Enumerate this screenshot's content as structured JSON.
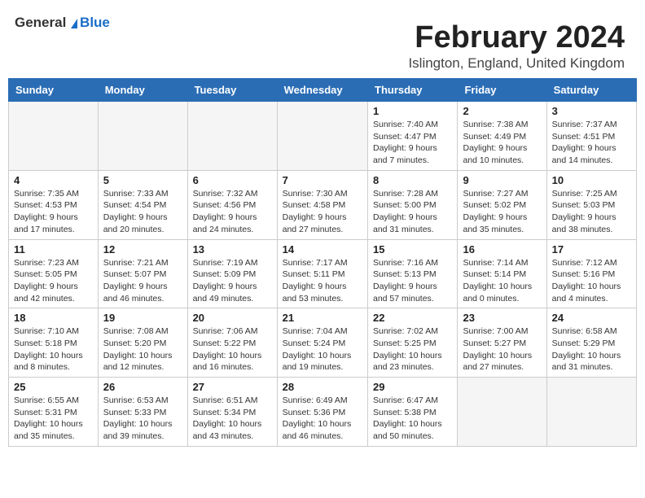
{
  "logo": {
    "general": "General",
    "blue": "Blue"
  },
  "header": {
    "title": "February 2024",
    "subtitle": "Islington, England, United Kingdom"
  },
  "weekdays": [
    "Sunday",
    "Monday",
    "Tuesday",
    "Wednesday",
    "Thursday",
    "Friday",
    "Saturday"
  ],
  "weeks": [
    [
      {
        "num": "",
        "info": ""
      },
      {
        "num": "",
        "info": ""
      },
      {
        "num": "",
        "info": ""
      },
      {
        "num": "",
        "info": ""
      },
      {
        "num": "1",
        "info": "Sunrise: 7:40 AM\nSunset: 4:47 PM\nDaylight: 9 hours\nand 7 minutes."
      },
      {
        "num": "2",
        "info": "Sunrise: 7:38 AM\nSunset: 4:49 PM\nDaylight: 9 hours\nand 10 minutes."
      },
      {
        "num": "3",
        "info": "Sunrise: 7:37 AM\nSunset: 4:51 PM\nDaylight: 9 hours\nand 14 minutes."
      }
    ],
    [
      {
        "num": "4",
        "info": "Sunrise: 7:35 AM\nSunset: 4:53 PM\nDaylight: 9 hours\nand 17 minutes."
      },
      {
        "num": "5",
        "info": "Sunrise: 7:33 AM\nSunset: 4:54 PM\nDaylight: 9 hours\nand 20 minutes."
      },
      {
        "num": "6",
        "info": "Sunrise: 7:32 AM\nSunset: 4:56 PM\nDaylight: 9 hours\nand 24 minutes."
      },
      {
        "num": "7",
        "info": "Sunrise: 7:30 AM\nSunset: 4:58 PM\nDaylight: 9 hours\nand 27 minutes."
      },
      {
        "num": "8",
        "info": "Sunrise: 7:28 AM\nSunset: 5:00 PM\nDaylight: 9 hours\nand 31 minutes."
      },
      {
        "num": "9",
        "info": "Sunrise: 7:27 AM\nSunset: 5:02 PM\nDaylight: 9 hours\nand 35 minutes."
      },
      {
        "num": "10",
        "info": "Sunrise: 7:25 AM\nSunset: 5:03 PM\nDaylight: 9 hours\nand 38 minutes."
      }
    ],
    [
      {
        "num": "11",
        "info": "Sunrise: 7:23 AM\nSunset: 5:05 PM\nDaylight: 9 hours\nand 42 minutes."
      },
      {
        "num": "12",
        "info": "Sunrise: 7:21 AM\nSunset: 5:07 PM\nDaylight: 9 hours\nand 46 minutes."
      },
      {
        "num": "13",
        "info": "Sunrise: 7:19 AM\nSunset: 5:09 PM\nDaylight: 9 hours\nand 49 minutes."
      },
      {
        "num": "14",
        "info": "Sunrise: 7:17 AM\nSunset: 5:11 PM\nDaylight: 9 hours\nand 53 minutes."
      },
      {
        "num": "15",
        "info": "Sunrise: 7:16 AM\nSunset: 5:13 PM\nDaylight: 9 hours\nand 57 minutes."
      },
      {
        "num": "16",
        "info": "Sunrise: 7:14 AM\nSunset: 5:14 PM\nDaylight: 10 hours\nand 0 minutes."
      },
      {
        "num": "17",
        "info": "Sunrise: 7:12 AM\nSunset: 5:16 PM\nDaylight: 10 hours\nand 4 minutes."
      }
    ],
    [
      {
        "num": "18",
        "info": "Sunrise: 7:10 AM\nSunset: 5:18 PM\nDaylight: 10 hours\nand 8 minutes."
      },
      {
        "num": "19",
        "info": "Sunrise: 7:08 AM\nSunset: 5:20 PM\nDaylight: 10 hours\nand 12 minutes."
      },
      {
        "num": "20",
        "info": "Sunrise: 7:06 AM\nSunset: 5:22 PM\nDaylight: 10 hours\nand 16 minutes."
      },
      {
        "num": "21",
        "info": "Sunrise: 7:04 AM\nSunset: 5:24 PM\nDaylight: 10 hours\nand 19 minutes."
      },
      {
        "num": "22",
        "info": "Sunrise: 7:02 AM\nSunset: 5:25 PM\nDaylight: 10 hours\nand 23 minutes."
      },
      {
        "num": "23",
        "info": "Sunrise: 7:00 AM\nSunset: 5:27 PM\nDaylight: 10 hours\nand 27 minutes."
      },
      {
        "num": "24",
        "info": "Sunrise: 6:58 AM\nSunset: 5:29 PM\nDaylight: 10 hours\nand 31 minutes."
      }
    ],
    [
      {
        "num": "25",
        "info": "Sunrise: 6:55 AM\nSunset: 5:31 PM\nDaylight: 10 hours\nand 35 minutes."
      },
      {
        "num": "26",
        "info": "Sunrise: 6:53 AM\nSunset: 5:33 PM\nDaylight: 10 hours\nand 39 minutes."
      },
      {
        "num": "27",
        "info": "Sunrise: 6:51 AM\nSunset: 5:34 PM\nDaylight: 10 hours\nand 43 minutes."
      },
      {
        "num": "28",
        "info": "Sunrise: 6:49 AM\nSunset: 5:36 PM\nDaylight: 10 hours\nand 46 minutes."
      },
      {
        "num": "29",
        "info": "Sunrise: 6:47 AM\nSunset: 5:38 PM\nDaylight: 10 hours\nand 50 minutes."
      },
      {
        "num": "",
        "info": ""
      },
      {
        "num": "",
        "info": ""
      }
    ]
  ]
}
